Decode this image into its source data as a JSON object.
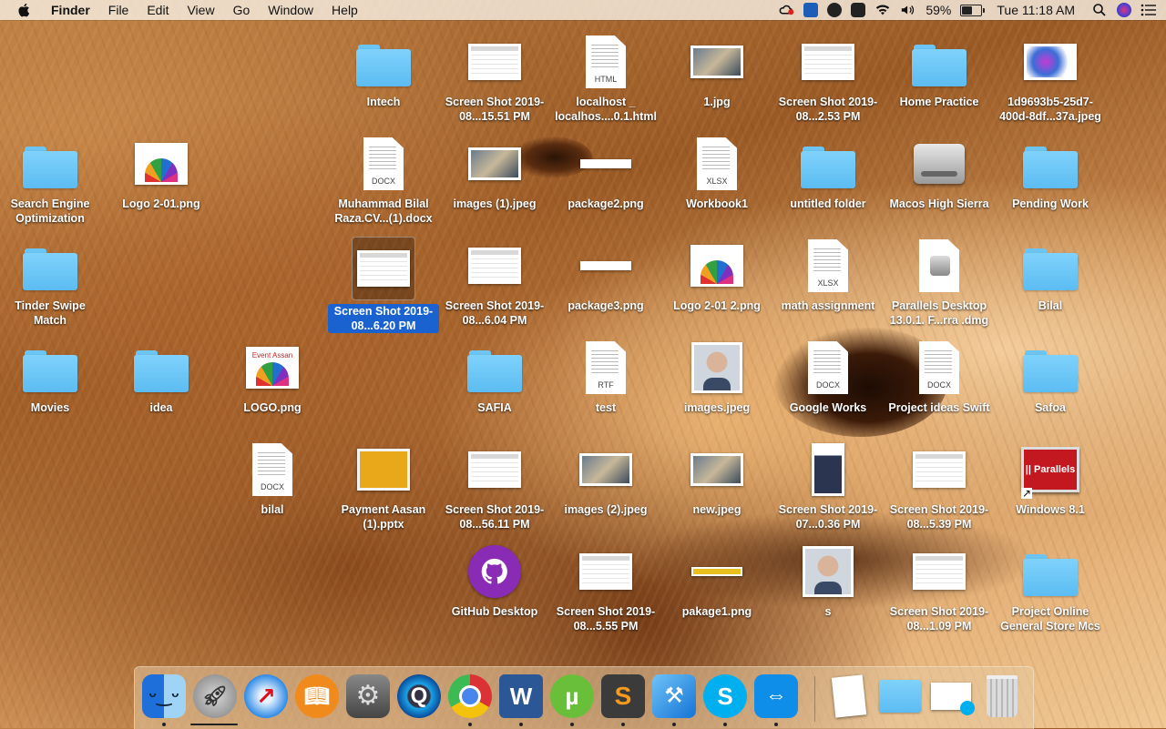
{
  "menubar": {
    "app_name": "Finder",
    "menus": [
      "File",
      "Edit",
      "View",
      "Go",
      "Window",
      "Help"
    ],
    "battery_percent": "59%",
    "battery_level": 0.59,
    "clock": "Tue 11:18 AM",
    "status_icons": [
      "creative-cloud-icon",
      "teamviewer-icon",
      "m-app-icon",
      "checkmark-app-icon",
      "wifi-icon",
      "volume-icon",
      "battery-icon",
      "search-icon",
      "siri-icon",
      "notification-center-icon"
    ]
  },
  "desktop": {
    "items": [
      {
        "label": "Intech",
        "kind": "folder"
      },
      {
        "label": "Screen Shot 2019-08...15.51 PM",
        "kind": "screenshot"
      },
      {
        "label": "localhost _ localhos....0.1.html",
        "kind": "doc",
        "ext": "HTML"
      },
      {
        "label": "1.jpg",
        "kind": "photo"
      },
      {
        "label": "Screen Shot 2019-08...2.53 PM",
        "kind": "screenshot"
      },
      {
        "label": "Home Practice",
        "kind": "folder"
      },
      {
        "label": "1d9693b5-25d7-400d-8df...37a.jpeg",
        "kind": "image"
      },
      {
        "label": "Search Engine Optimization",
        "kind": "folder"
      },
      {
        "label": "Logo 2-01.png",
        "kind": "logo"
      },
      {
        "label": "Muhammad Bilal Raza.CV...(1).docx",
        "kind": "doc",
        "ext": "DOCX"
      },
      {
        "label": "images (1).jpeg",
        "kind": "photo"
      },
      {
        "label": "package2.png",
        "kind": "strip"
      },
      {
        "label": "Workbook1",
        "kind": "doc",
        "ext": "XLSX"
      },
      {
        "label": "untitled folder",
        "kind": "folder"
      },
      {
        "label": "Macos High Sierra",
        "kind": "drive"
      },
      {
        "label": "Pending Work",
        "kind": "folder"
      },
      {
        "label": "Tinder Swipe Match",
        "kind": "folder"
      },
      {
        "label": "Screen Shot 2019-08...6.20 PM",
        "kind": "screenshot",
        "selected": true
      },
      {
        "label": "Screen Shot 2019-08...6.04 PM",
        "kind": "screenshot"
      },
      {
        "label": "package3.png",
        "kind": "strip"
      },
      {
        "label": "Logo 2-01 2.png",
        "kind": "logo"
      },
      {
        "label": "math assignment",
        "kind": "doc",
        "ext": "XLSX"
      },
      {
        "label": "Parallels Desktop 13.0.1. F...rra .dmg",
        "kind": "dmg"
      },
      {
        "label": "Bilal",
        "kind": "folder"
      },
      {
        "label": "Movies",
        "kind": "folder"
      },
      {
        "label": "idea",
        "kind": "folder"
      },
      {
        "label": "LOGO.png",
        "kind": "logo",
        "caption": "Event Assan"
      },
      {
        "label": "SAFIA",
        "kind": "folder"
      },
      {
        "label": "test",
        "kind": "doc",
        "ext": "RTF"
      },
      {
        "label": "images.jpeg",
        "kind": "portrait"
      },
      {
        "label": "Google Works",
        "kind": "doc",
        "ext": "DOCX"
      },
      {
        "label": "Project ideas Swift",
        "kind": "doc",
        "ext": "DOCX"
      },
      {
        "label": "Safoa",
        "kind": "folder"
      },
      {
        "label": "bilal",
        "kind": "doc",
        "ext": "DOCX"
      },
      {
        "label": "Payment Aasan (1).pptx",
        "kind": "pptx"
      },
      {
        "label": "Screen Shot 2019-08...56.11 PM",
        "kind": "screenshot"
      },
      {
        "label": "images (2).jpeg",
        "kind": "photo"
      },
      {
        "label": "new.jpeg",
        "kind": "photo"
      },
      {
        "label": "Screen Shot 2019-07...0.36 PM",
        "kind": "tall"
      },
      {
        "label": "Screen Shot 2019-08...5.39 PM",
        "kind": "screenshot"
      },
      {
        "label": "Windows 8.1",
        "kind": "parallels",
        "caption": "|| Parallels"
      },
      {
        "label": "GitHub Desktop",
        "kind": "github"
      },
      {
        "label": "Screen Shot 2019-08...5.55 PM",
        "kind": "screenshot"
      },
      {
        "label": "pakage1.png",
        "kind": "strip-yellow"
      },
      {
        "label": "s",
        "kind": "portrait"
      },
      {
        "label": "Screen Shot 2019-08...1.09 PM",
        "kind": "screenshot"
      },
      {
        "label": "Project Online General Store Mcs",
        "kind": "folder"
      }
    ]
  },
  "dock": {
    "apps": [
      {
        "name": "finder-icon",
        "running": true
      },
      {
        "name": "launchpad-icon",
        "running": false
      },
      {
        "name": "safari-icon",
        "running": false
      },
      {
        "name": "ibooks-icon",
        "running": false
      },
      {
        "name": "system-preferences-icon",
        "running": false
      },
      {
        "name": "quicktime-icon",
        "running": false
      },
      {
        "name": "chrome-icon",
        "running": true
      },
      {
        "name": "word-icon",
        "running": true
      },
      {
        "name": "utorrent-icon",
        "running": true
      },
      {
        "name": "sublime-text-icon",
        "running": true
      },
      {
        "name": "xcode-icon",
        "running": true
      },
      {
        "name": "skype-icon",
        "running": true
      },
      {
        "name": "teamviewer-icon",
        "running": true
      }
    ],
    "stacks": [
      "document-stack-icon",
      "folder-stack-icon",
      "downloads-stack-icon",
      "trash-icon"
    ]
  }
}
